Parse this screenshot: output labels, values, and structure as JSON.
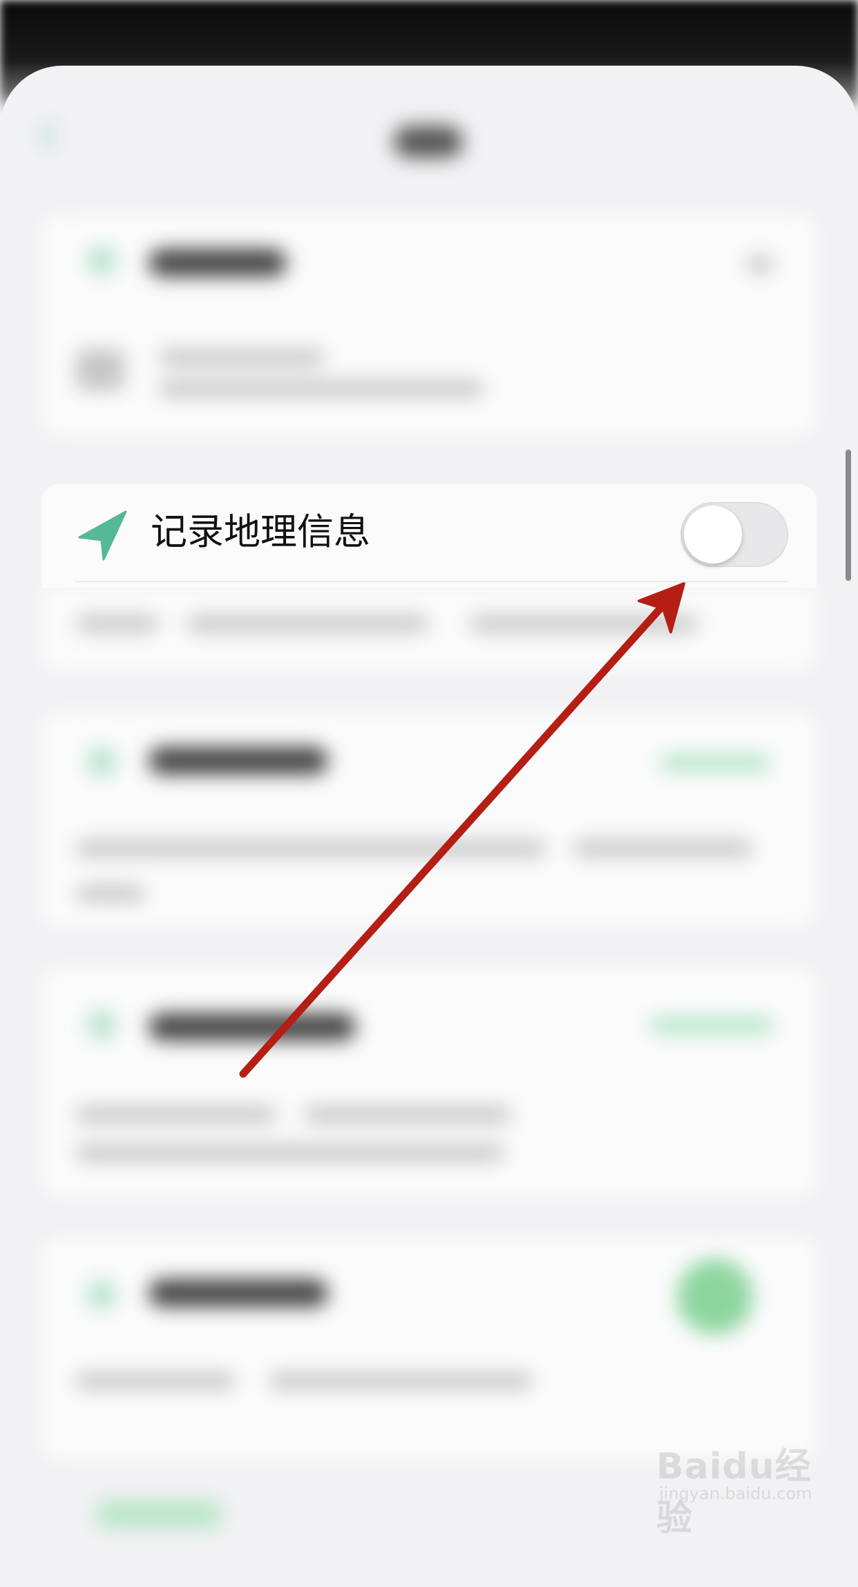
{
  "location_setting": {
    "label": "记录地理信息",
    "toggle_state": "off",
    "icon": "location-arrow-icon",
    "icon_color": "#55b896"
  },
  "annotation": {
    "arrow_color": "#b41e14"
  },
  "watermark": {
    "brand": "Baidu经验",
    "url": "jingyan.baidu.com"
  }
}
